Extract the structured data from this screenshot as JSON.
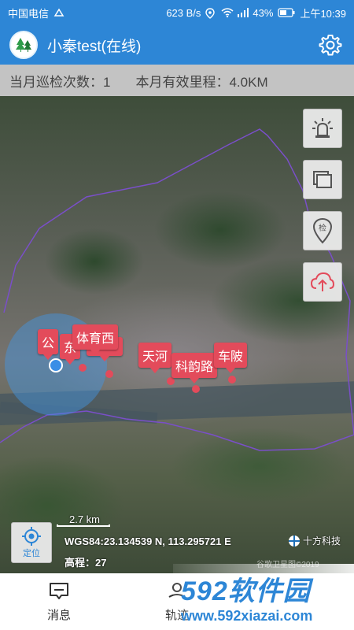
{
  "status_bar": {
    "carrier": "中国电信",
    "speed": "623 B/s",
    "battery": "43%",
    "time": "上午10:39"
  },
  "app_bar": {
    "title": "小秦test(在线)",
    "logo_icon": "tree-logo-icon",
    "settings_icon": "gear-icon"
  },
  "stats": {
    "patrol_count": "当月巡检次数：1",
    "mileage": "本月有效里程：4.0KM"
  },
  "map": {
    "markers": [
      {
        "label": "公"
      },
      {
        "label": "东"
      },
      {
        "label": "体育西"
      },
      {
        "label": "天河"
      },
      {
        "label": "科韵路"
      },
      {
        "label": "车陂"
      }
    ],
    "side_buttons": [
      {
        "name": "alarm-light-icon"
      },
      {
        "name": "layers-icon"
      },
      {
        "name": "inspect-pin-icon",
        "glyph": "检"
      },
      {
        "name": "cloud-upload-icon"
      }
    ],
    "scale_label": "2.7 km",
    "locate_label": "定位",
    "coordinates": "WGS84:23.134539 N, 113.295721 E",
    "elevation": "高程：27",
    "provider": "十方科技",
    "copyright": "谷歌卫星图©2019"
  },
  "bottom_nav": {
    "items": [
      {
        "label": "消息",
        "icon": "message-icon"
      },
      {
        "label": "轨迹",
        "icon": "track-icon"
      }
    ]
  },
  "watermark": {
    "big": "592软件园",
    "small": "www.592xiazai.com"
  },
  "colors": {
    "primary": "#2d86d6",
    "marker": "#e34b5b",
    "boundary": "#7a4fc9"
  }
}
